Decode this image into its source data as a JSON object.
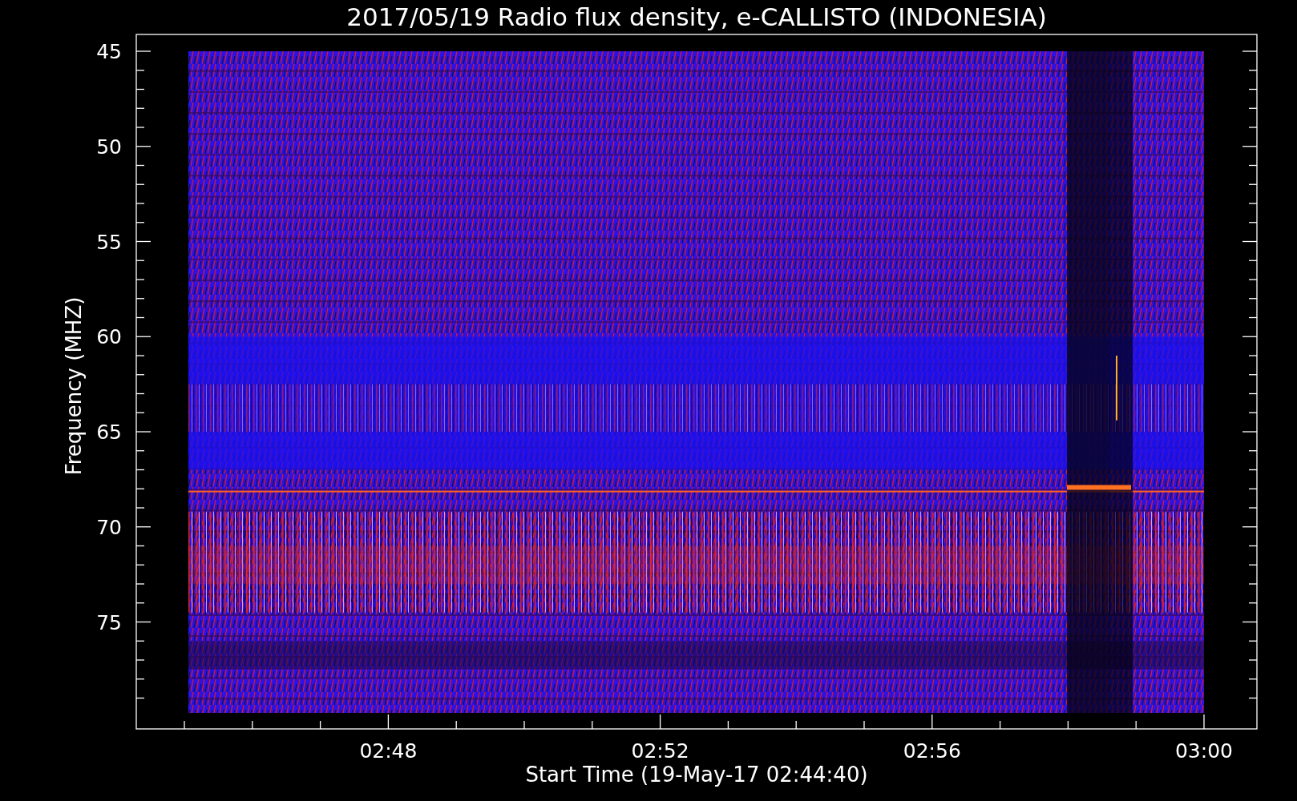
{
  "title": "2017/05/19  Radio flux density, e-CALLISTO (INDONESIA)",
  "y_axis": {
    "label": "Frequency (MHZ)",
    "ticks": [
      "45",
      "50",
      "55",
      "60",
      "65",
      "70",
      "75"
    ]
  },
  "x_axis": {
    "label": "Start Time (19-May-17 02:44:40)",
    "ticks": [
      "02:48",
      "02:52",
      "02:56",
      "03:00"
    ]
  }
}
